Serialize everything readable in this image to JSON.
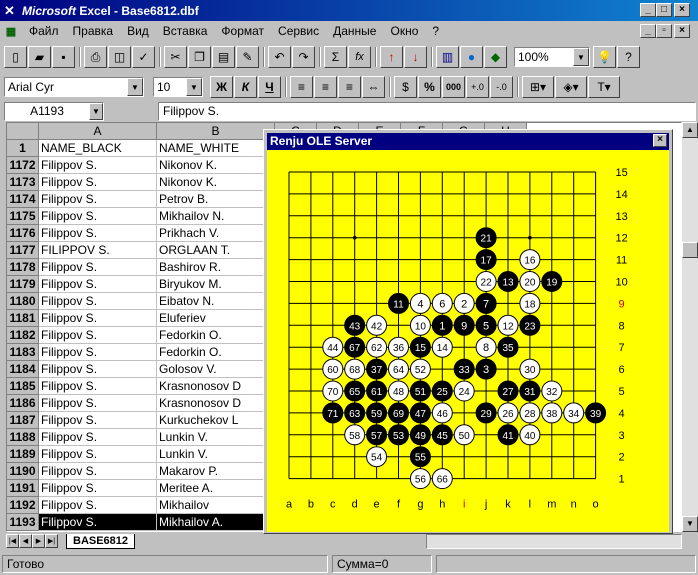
{
  "app": {
    "title_brand": "Microsoft",
    "title_rest": " Excel - Base6812.dbf"
  },
  "menu": [
    "Файл",
    "Правка",
    "Вид",
    "Вставка",
    "Формат",
    "Сервис",
    "Данные",
    "Окно",
    "?"
  ],
  "toolbar": {
    "zoom": "100%",
    "font": "Arial Cyr",
    "size": "10",
    "bold": "Ж",
    "italic": "К",
    "underline": "Ч",
    "sum": "Σ",
    "fx": "fx",
    "percent": "%",
    "thousands": "000"
  },
  "formula": {
    "cell": "A1193",
    "value": "Filippov S."
  },
  "columns": [
    {
      "id": "A",
      "header": "NAME_BLACK"
    },
    {
      "id": "B",
      "header": "NAME_WHITE"
    },
    {
      "id": "C"
    },
    {
      "id": "D"
    },
    {
      "id": "E"
    },
    {
      "id": "F"
    },
    {
      "id": "G"
    },
    {
      "id": "H"
    }
  ],
  "header_row_num": "1",
  "rows": [
    {
      "n": "1172",
      "a": "Filippov S.",
      "b": "Nikonov K."
    },
    {
      "n": "1173",
      "a": "Filippov S.",
      "b": "Nikonov K."
    },
    {
      "n": "1174",
      "a": "Filippov S.",
      "b": "Petrov B."
    },
    {
      "n": "1175",
      "a": "Filippov S.",
      "b": "Mikhailov N."
    },
    {
      "n": "1176",
      "a": "Filippov S.",
      "b": "Prikhach V."
    },
    {
      "n": "1177",
      "a": "FILIPPOV S.",
      "b": "ORGLAAN T."
    },
    {
      "n": "1178",
      "a": "Filippov S.",
      "b": "Bashirov R."
    },
    {
      "n": "1179",
      "a": "Filippov S.",
      "b": "Biryukov M."
    },
    {
      "n": "1180",
      "a": "Filippov S.",
      "b": "Eibatov N."
    },
    {
      "n": "1181",
      "a": "Filippov S.",
      "b": "Eluferiev"
    },
    {
      "n": "1182",
      "a": "Filippov S.",
      "b": "Fedorkin O."
    },
    {
      "n": "1183",
      "a": "Filippov S.",
      "b": "Fedorkin O."
    },
    {
      "n": "1184",
      "a": "Filippov S.",
      "b": "Golosov V."
    },
    {
      "n": "1185",
      "a": "Filippov S.",
      "b": "Krasnonosov D"
    },
    {
      "n": "1186",
      "a": "Filippov S.",
      "b": "Krasnonosov D"
    },
    {
      "n": "1187",
      "a": "Filippov S.",
      "b": "Kurkuchekov L"
    },
    {
      "n": "1188",
      "a": "Filippov S.",
      "b": "Lunkin V."
    },
    {
      "n": "1189",
      "a": "Filippov S.",
      "b": "Lunkin V."
    },
    {
      "n": "1190",
      "a": "Filippov S.",
      "b": "Makarov P."
    },
    {
      "n": "1191",
      "a": "Filippov S.",
      "b": "Meritee A."
    },
    {
      "n": "1192",
      "a": "Filippov S.",
      "b": "Mikhailov"
    },
    {
      "n": "1193",
      "a": "Filippov S.",
      "b": "Mikhailov A.",
      "selected": true
    }
  ],
  "sheet_tab": "BASE6812",
  "status": {
    "ready": "Готово",
    "sum": "Сумма=0"
  },
  "renju": {
    "title": "Renju OLE Server",
    "board_color": "#ffff00",
    "letters": [
      "a",
      "b",
      "c",
      "d",
      "e",
      "f",
      "g",
      "h",
      "i",
      "j",
      "k",
      "l",
      "m",
      "n",
      "o"
    ],
    "highlight_col": "i",
    "highlight_row": "9",
    "moves": [
      {
        "n": "1",
        "c": "h8"
      },
      {
        "n": "2",
        "c": "i9"
      },
      {
        "n": "3",
        "c": "j6"
      },
      {
        "n": "4",
        "c": "g9"
      },
      {
        "n": "5",
        "c": "j8"
      },
      {
        "n": "6",
        "c": "h9"
      },
      {
        "n": "7",
        "c": "j9"
      },
      {
        "n": "8",
        "c": "j7"
      },
      {
        "n": "9",
        "c": "i8"
      },
      {
        "n": "10",
        "c": "g8"
      },
      {
        "n": "11",
        "c": "f9"
      },
      {
        "n": "12",
        "c": "k8"
      },
      {
        "n": "13",
        "c": "k10"
      },
      {
        "n": "14",
        "c": "h7"
      },
      {
        "n": "15",
        "c": "g7"
      },
      {
        "n": "16",
        "c": "l11"
      },
      {
        "n": "17",
        "c": "j11"
      },
      {
        "n": "18",
        "c": "l9"
      },
      {
        "n": "19",
        "c": "m10"
      },
      {
        "n": "20",
        "c": "l10"
      },
      {
        "n": "21",
        "c": "j12"
      },
      {
        "n": "22",
        "c": "j10"
      },
      {
        "n": "23",
        "c": "l8"
      },
      {
        "n": "24",
        "c": "i5"
      },
      {
        "n": "25",
        "c": "h5"
      },
      {
        "n": "26",
        "c": "k4"
      },
      {
        "n": "27",
        "c": "k5"
      },
      {
        "n": "28",
        "c": "l4"
      },
      {
        "n": "29",
        "c": "j4"
      },
      {
        "n": "30",
        "c": "l6"
      },
      {
        "n": "31",
        "c": "l5"
      },
      {
        "n": "32",
        "c": "m5"
      },
      {
        "n": "33",
        "c": "i6"
      },
      {
        "n": "34",
        "c": "n4"
      },
      {
        "n": "35",
        "c": "k7"
      },
      {
        "n": "36",
        "c": "f7"
      },
      {
        "n": "37",
        "c": "e6"
      },
      {
        "n": "38",
        "c": "m4"
      },
      {
        "n": "39",
        "c": "o4"
      },
      {
        "n": "40",
        "c": "l3"
      },
      {
        "n": "41",
        "c": "k3"
      },
      {
        "n": "42",
        "c": "e8"
      },
      {
        "n": "43",
        "c": "d8"
      },
      {
        "n": "44",
        "c": "c7"
      },
      {
        "n": "45",
        "c": "h3"
      },
      {
        "n": "46",
        "c": "h4"
      },
      {
        "n": "47",
        "c": "g4"
      },
      {
        "n": "48",
        "c": "f5"
      },
      {
        "n": "49",
        "c": "g3"
      },
      {
        "n": "50",
        "c": "i3"
      },
      {
        "n": "51",
        "c": "g5"
      },
      {
        "n": "52",
        "c": "g6"
      },
      {
        "n": "53",
        "c": "f3"
      },
      {
        "n": "54",
        "c": "e2"
      },
      {
        "n": "55",
        "c": "g2"
      },
      {
        "n": "56",
        "c": "g1"
      },
      {
        "n": "57",
        "c": "e3"
      },
      {
        "n": "58",
        "c": "d3"
      },
      {
        "n": "59",
        "c": "e4"
      },
      {
        "n": "60",
        "c": "c6"
      },
      {
        "n": "61",
        "c": "e5"
      },
      {
        "n": "62",
        "c": "e7"
      },
      {
        "n": "63",
        "c": "d4"
      },
      {
        "n": "64",
        "c": "f6"
      },
      {
        "n": "65",
        "c": "d5"
      },
      {
        "n": "66",
        "c": "h1"
      },
      {
        "n": "67",
        "c": "d7"
      },
      {
        "n": "68",
        "c": "d6"
      },
      {
        "n": "69",
        "c": "f4"
      },
      {
        "n": "70",
        "c": "c5"
      },
      {
        "n": "71",
        "c": "c4"
      }
    ]
  }
}
